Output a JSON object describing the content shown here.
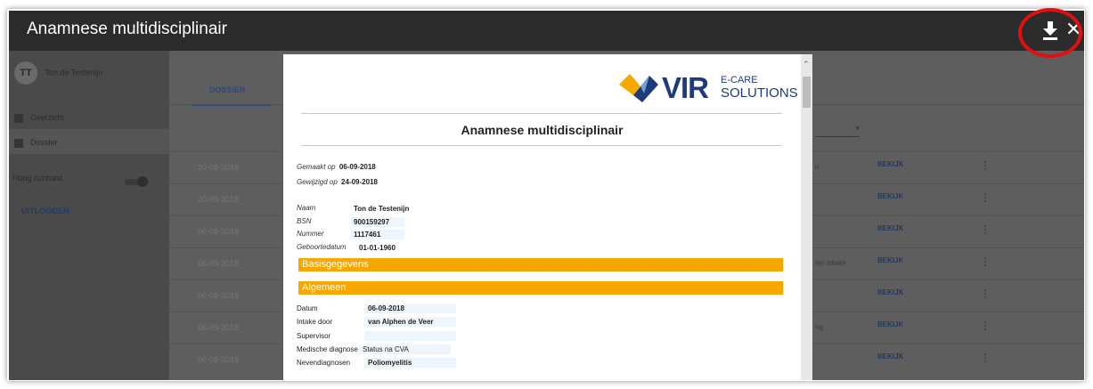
{
  "window": {
    "title": "Anamnese multidisciplinair",
    "download_icon": "download-icon",
    "close_icon": "close-icon",
    "close_glyph": "✕"
  },
  "sidebar": {
    "avatar_initials": "TT",
    "user_name": "Ton de Testenijn",
    "items": [
      {
        "label": "Overzicht",
        "icon": "dashboard-icon"
      },
      {
        "label": "Dossier",
        "icon": "folder-icon"
      }
    ],
    "contrast_label": "Hoog contrast",
    "logout_label": "UITLOGGEN"
  },
  "tabs": [
    {
      "label": "DOSSIER"
    }
  ],
  "table": {
    "rows": [
      {
        "date": "20-09-2018",
        "desc": "n",
        "action": "BEKIJK"
      },
      {
        "date": "20-09-2018",
        "desc": "",
        "action": "BEKIJK"
      },
      {
        "date": "06-09-2018",
        "desc": "",
        "action": "BEKIJK"
      },
      {
        "date": "06-09-2018",
        "desc": "ten intake",
        "action": "BEKIJK"
      },
      {
        "date": "06-09-2018",
        "desc": "",
        "action": "BEKIJK"
      },
      {
        "date": "06-09-2018",
        "desc": "ng",
        "action": "BEKIJK"
      },
      {
        "date": "06-09-2018",
        "desc": "",
        "action": "BEKIJK"
      }
    ],
    "kebab_glyph": "⋮"
  },
  "document": {
    "logo": {
      "name": "VIR",
      "line1": "E-CARE",
      "line2": "SOLUTIONS"
    },
    "title": "Anamnese multidisciplinair",
    "created_label": "Gemaakt op",
    "created_value": "06-09-2018",
    "modified_label": "Gewijzigd op",
    "modified_value": "24-09-2018",
    "fields": [
      {
        "label": "Naam",
        "value": "Ton de Testenijn"
      },
      {
        "label": "BSN",
        "value": "900159297"
      },
      {
        "label": "Nummer",
        "value": "1117461"
      },
      {
        "label": "Geboortedatum",
        "value": "01-01-1960"
      }
    ],
    "section1": "Basisgegevens",
    "section2": "Algemeen",
    "algemeen": [
      {
        "label": "Datum",
        "value": "06-09-2018"
      },
      {
        "label": "Intake door",
        "value": "van Alphen de Veer"
      },
      {
        "label": "Supervisor",
        "value": ""
      },
      {
        "label": "Medische diagnose",
        "value": "Status na CVA"
      },
      {
        "label": "Nevendiagnosen",
        "value": "Poliomyelitis"
      }
    ]
  },
  "colors": {
    "titlebar": "#2b2b2b",
    "accent": "#f6a800",
    "highlight_ring": "#e01010",
    "brand": "#1e3a7a"
  }
}
